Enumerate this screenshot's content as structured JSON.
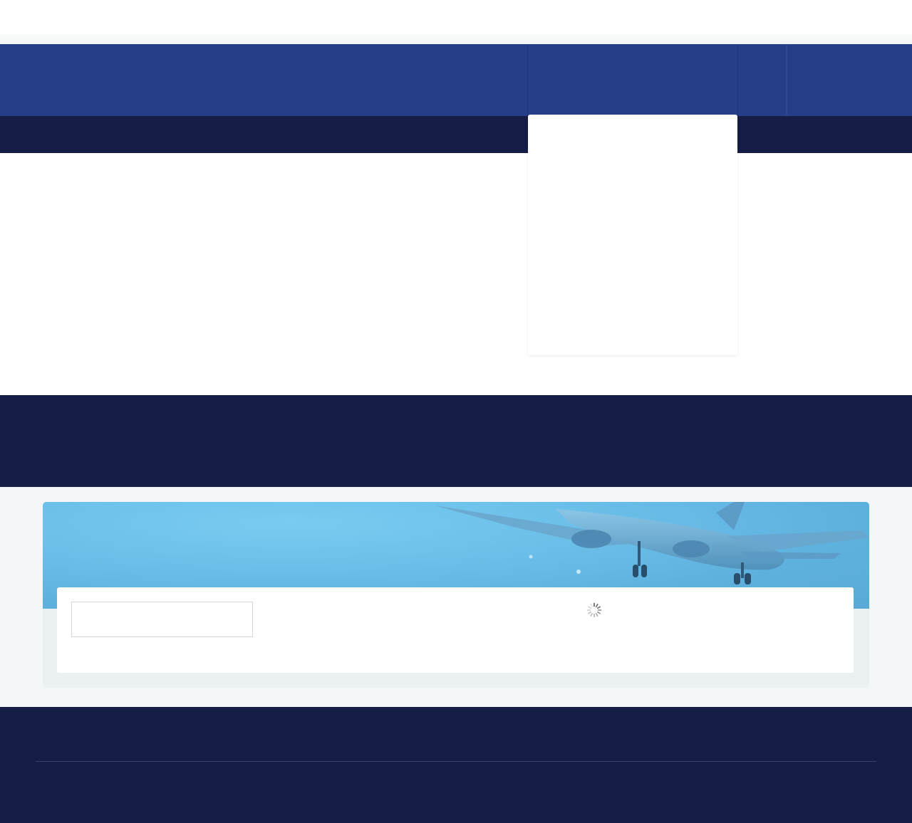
{
  "colors": {
    "primary_nav": "#263d87",
    "dark_navy": "#151c46",
    "page_bg": "#ffffff",
    "section_bg": "#f3f7f8",
    "hero_sky": "#6bc0ea"
  },
  "search": {
    "input_value": "",
    "placeholder": ""
  },
  "hero": {
    "image_icon": "airplane-landing-image"
  },
  "loading": {
    "icon": "spinner-icon"
  }
}
